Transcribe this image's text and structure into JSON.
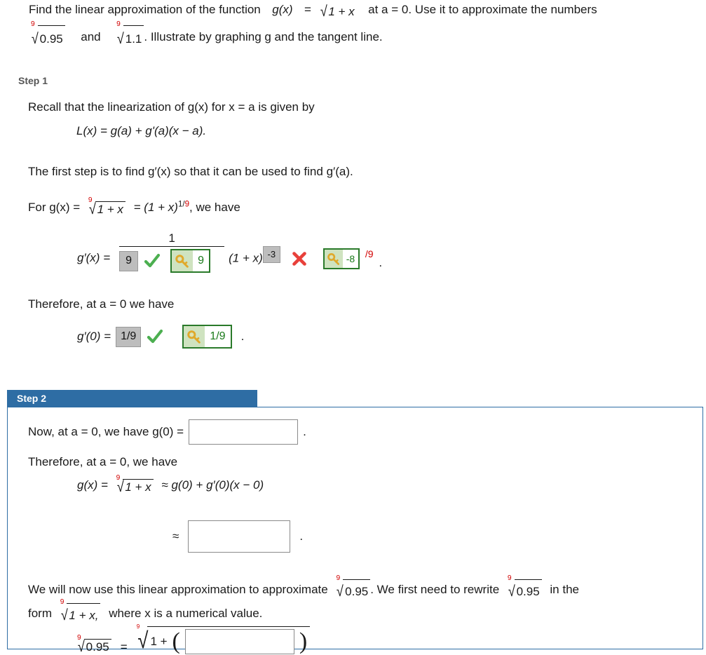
{
  "problem": {
    "line1_a": "Find the linear approximation of the function",
    "line1_fn": "g(x)",
    "line1_eq": "=",
    "line1_radicand": "1 + x",
    "line1_b": "at a = 0. Use it to approximate the numbers",
    "line2_rad1": "0.95",
    "line2_and": "and",
    "line2_rad2": "1.1",
    "line2_b": ". Illustrate by graphing g and the tangent line.",
    "root_index": "9"
  },
  "step1": {
    "label": "Step 1",
    "p1": "Recall that the linearization of  g(x)  for x = a is given by",
    "eq1": "L(x) = g(a) + g'(a)(x − a).",
    "p2": "The first step is to find  g′(x)  so that it can be used to find  g′(a).",
    "p3_pre": "For  g(x) =",
    "p3_radicand": "1 + x",
    "p3_mid": "= (1 + x)",
    "p3_exp_num": "1/",
    "p3_exp_den": "9",
    "p3_post": ",  we have",
    "deriv": {
      "lhs": "g′(x)  =",
      "numerator": "1",
      "denominator_answer": "9",
      "denominator_key": "9",
      "base": "(1 + x)",
      "exponent_answer": "-3",
      "exponent_key": "-8",
      "exponent_key_suffix": "/9",
      "period": ".",
      "denominator_status": "correct",
      "exponent_status": "incorrect"
    },
    "p4": "Therefore, at  a = 0  we have",
    "g0": {
      "lhs": "g′(0)  =",
      "answer": "1/9",
      "key": "1/9",
      "period": ".",
      "status": "correct"
    }
  },
  "step2": {
    "label": "Step 2",
    "p1_pre": "Now, at  a = 0,  we have  g(0) =",
    "p1_input_value": "",
    "p1_placeholder": "",
    "p1_post": ".",
    "p2": "Therefore, at  a = 0,  we have",
    "eq1_pre": "g(x)  =",
    "eq1_radicand": "1 + x",
    "eq1_post": "≈  g(0) + g′(0)(x − 0)",
    "approx_sign": "≈",
    "approx_input_value": "",
    "approx_period": ".",
    "p3_a": "We will now use this linear approximation to approximate",
    "p3_rad1": "0.95",
    "p3_b": ".  We first need to rewrite",
    "p3_rad2": "0.95",
    "p3_c": "in the",
    "p3_d": "form",
    "p3_rad3": "1 + x,",
    "p3_e": "where x is a numerical value.",
    "last": {
      "rad_left": "0.95",
      "equals": "=",
      "rad_right_pre": "1 +",
      "paren_open": "(",
      "input_value": "",
      "paren_close": ")"
    }
  },
  "colors": {
    "step_banner": "#2e6da4",
    "root_index_red": "#d10000",
    "key_green": "#2a7a2a",
    "key_fill": "#cfe3c0",
    "answer_gray": "#bdbdbd",
    "check_green": "#4caf50",
    "cross_red": "#e8403a"
  },
  "icons": {
    "check": "check-icon",
    "cross": "cross-icon",
    "key": "key-icon"
  }
}
